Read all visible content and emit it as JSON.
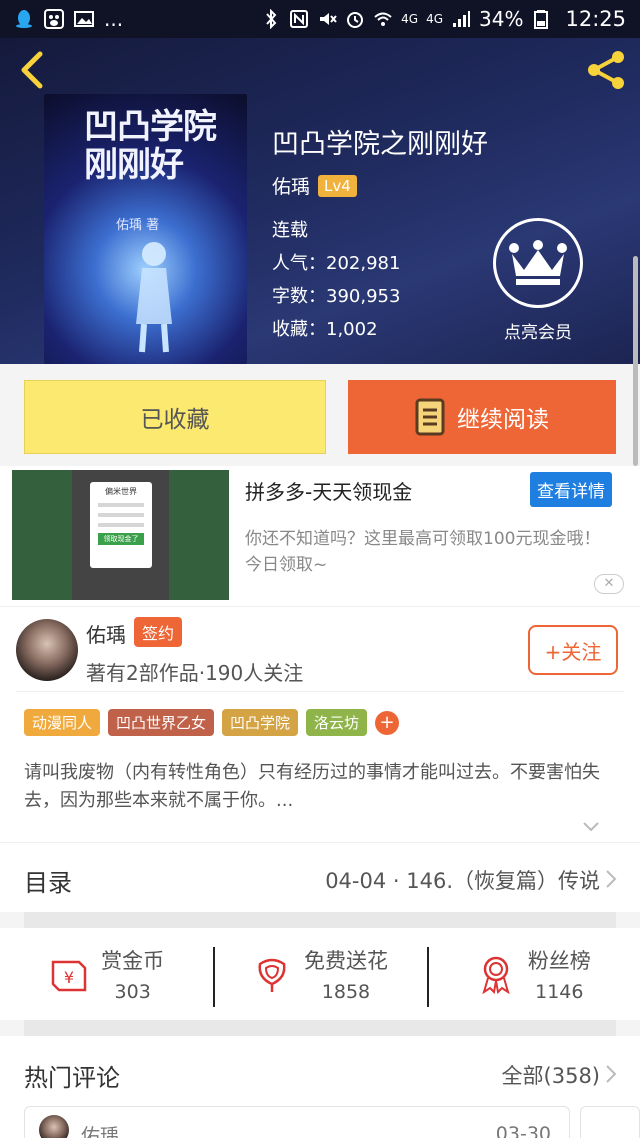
{
  "status_bar": {
    "network_1": "4G",
    "network_2": "4G",
    "battery": "34%",
    "time": "12:25",
    "ellipsis": "..."
  },
  "book": {
    "cover_title": "凹凸学院刚刚好",
    "cover_author": "佑瑀 著",
    "title": "凹凸学院之刚刚好",
    "author": "佑瑀",
    "level": "Lv4",
    "status": "连载",
    "popularity": "人气：202,981",
    "word_count": "字数：390,953",
    "favorites": "收藏：1,002",
    "vip_label": "点亮会员"
  },
  "actions": {
    "collected_label": "已收藏",
    "continue_label": "继续阅读"
  },
  "ad": {
    "title": "拼多多-天天领现金",
    "detail_button": "查看详情",
    "description": "你还不知道吗？这里最高可领取100元现金哦！今日领取~",
    "close": "✕",
    "img_header": "偏米世界",
    "img_button": "领取现金了"
  },
  "author_card": {
    "name": "佑瑀",
    "sign_badge": "签约",
    "works": "著有2部作品·190人关注",
    "follow_label": "+关注",
    "tags": [
      {
        "label": "动漫同人",
        "color": "#f0a93c"
      },
      {
        "label": "凹凸世界乙女",
        "color": "#c0614a"
      },
      {
        "label": "凹凸学院",
        "color": "#d4a444"
      },
      {
        "label": "洛云坊",
        "color": "#8fb44a"
      }
    ],
    "tag_add": "+",
    "intro": "请叫我废物（内有转性角色）只有经历过的事情才能叫过去。不要害怕失去，因为那些本来就不属于你。..."
  },
  "catalog": {
    "title": "目录",
    "latest": "04-04 · 146.（恢复篇）传说"
  },
  "stats": [
    {
      "label": "赏金币",
      "value": "303",
      "icon": "coin-envelope-icon"
    },
    {
      "label": "免费送花",
      "value": "1858",
      "icon": "flower-icon"
    },
    {
      "label": "粉丝榜",
      "value": "1146",
      "icon": "medal-icon"
    }
  ],
  "comments": {
    "title": "热门评论",
    "all_label": "全部(358)",
    "first_user": "佑瑀",
    "first_date": "03-30"
  },
  "colors": {
    "accent": "#ee6536",
    "collected_bg": "#fbe970",
    "ad_button": "#1e7fe0",
    "hero_bg": "#1f2a5e"
  }
}
